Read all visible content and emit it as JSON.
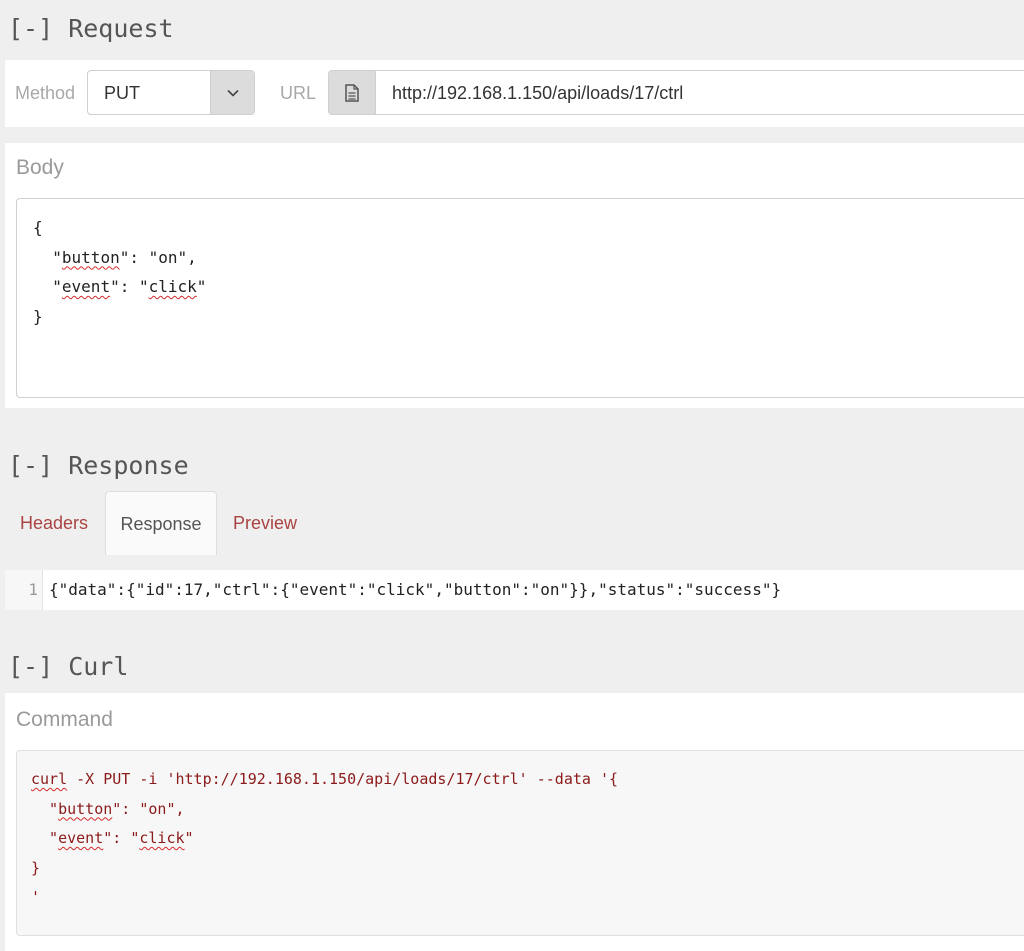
{
  "request": {
    "title": "[-] Request",
    "method_label": "Method",
    "method_value": "PUT",
    "url_label": "URL",
    "url_value": "http://192.168.1.150/api/loads/17/ctrl",
    "body_heading": "Body",
    "body_lines": [
      "{",
      "  \"button\": \"on\",",
      "  \"event\": \"click\"",
      "}"
    ]
  },
  "response": {
    "title": "[-] Response",
    "tabs": [
      {
        "label": "Headers",
        "active": false
      },
      {
        "label": "Response",
        "active": true
      },
      {
        "label": "Preview",
        "active": false
      }
    ],
    "line_number": "1",
    "content": "{\"data\":{\"id\":17,\"ctrl\":{\"event\":\"click\",\"button\":\"on\"}},\"status\":\"success\"}"
  },
  "curl": {
    "title": "[-] Curl",
    "command_heading": "Command",
    "command_lines": [
      "curl -X PUT -i 'http://192.168.1.150/api/loads/17/ctrl' --data '{",
      "  \"button\": \"on\",",
      "  \"event\": \"click\"",
      "}",
      "'"
    ]
  },
  "icons": {
    "method_dropdown": "chevron-down-icon",
    "url_field": "document-icon"
  },
  "colors": {
    "tab_link": "#a94442",
    "curl_text": "#8b1a1a",
    "spellcheck": "#d42a2a"
  }
}
